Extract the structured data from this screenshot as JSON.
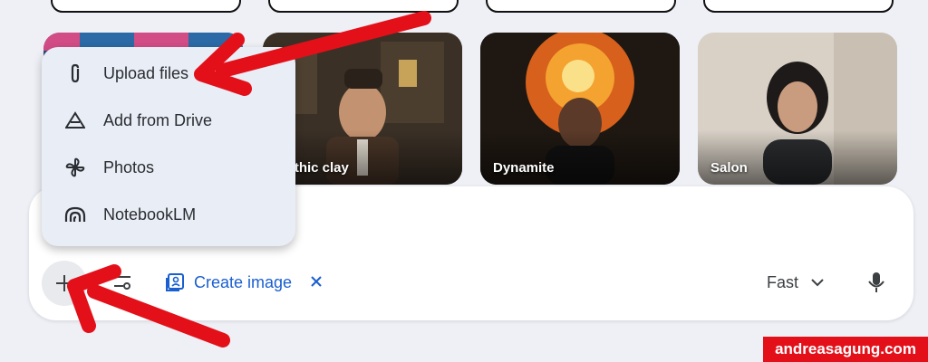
{
  "styles": [
    {
      "label": ""
    },
    {
      "label": "Gothic clay"
    },
    {
      "label": "Dynamite"
    },
    {
      "label": "Salon"
    }
  ],
  "upload_menu": {
    "items": [
      {
        "label": "Upload files",
        "icon": "paperclip-icon"
      },
      {
        "label": "Add from Drive",
        "icon": "drive-icon"
      },
      {
        "label": "Photos",
        "icon": "photos-icon"
      },
      {
        "label": "NotebookLM",
        "icon": "notebooklm-icon"
      }
    ]
  },
  "composer": {
    "tool_chip": "Create image",
    "mode": "Fast"
  },
  "watermark": "andreasagung.com",
  "colors": {
    "accent": "#1a5fd0",
    "annotation_arrow": "#e3101a",
    "background": "#eef0f6"
  }
}
